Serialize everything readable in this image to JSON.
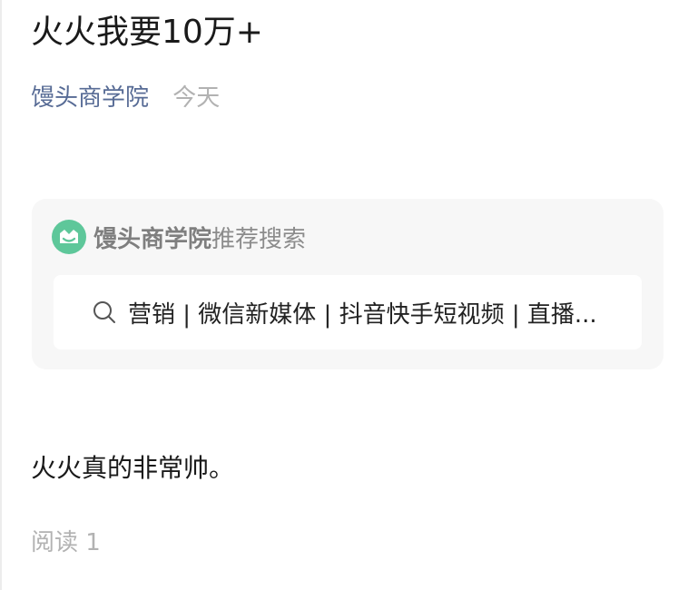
{
  "article": {
    "title": "火火我要10万+",
    "account_name": "馒头商学院",
    "date": "今天",
    "body": "火火真的非常帅。",
    "read_count": "阅读 1"
  },
  "search_card": {
    "brand_name": "馒头商学院",
    "brand_suffix": "推荐搜索",
    "logo_icon": "bear-face-logo-icon",
    "logo_color": "#5ec79a",
    "search_icon": "search-icon",
    "search_text": "营销 | 微信新媒体 | 抖音快手短视频 | 直播..."
  }
}
